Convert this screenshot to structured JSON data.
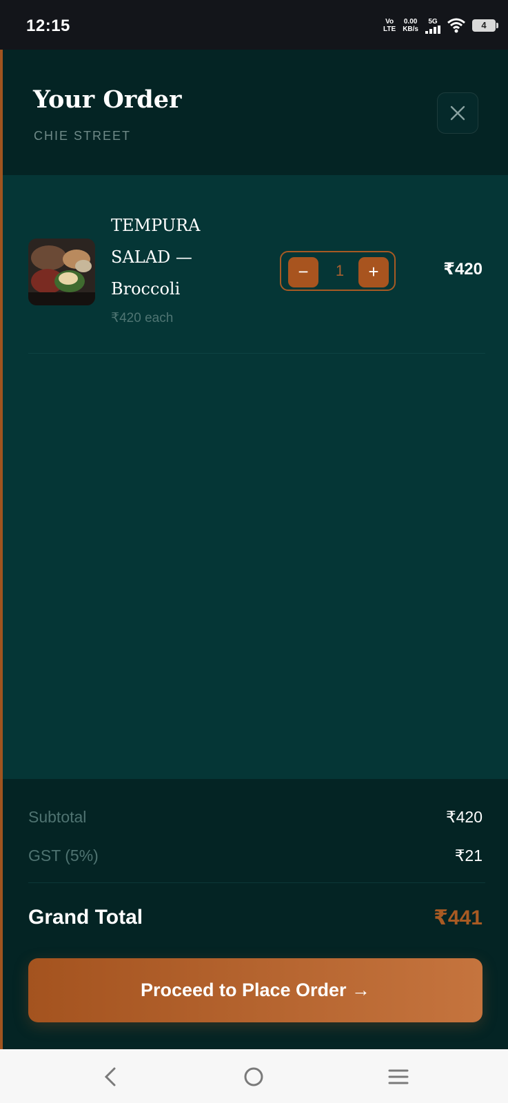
{
  "status_bar": {
    "time": "12:15",
    "volte_top": "Vo",
    "volte_bottom": "LTE",
    "speed_top": "0.00",
    "speed_bottom": "KB/s",
    "network": "5G",
    "battery": "4"
  },
  "header": {
    "title": "Your Order",
    "subtitle": "CHIE STREET",
    "close_icon": "close-icon"
  },
  "items": [
    {
      "name": "TEMPURA SALAD — Broccoli",
      "unit_price": "₹420 each",
      "quantity": "1",
      "minus_label": "−",
      "plus_label": "+",
      "total": "₹420"
    }
  ],
  "summary": {
    "subtotal_label": "Subtotal",
    "subtotal_value": "₹420",
    "gst_label": "GST (5%)",
    "gst_value": "₹21",
    "grand_total_label": "Grand Total",
    "grand_total_value": "₹441"
  },
  "cta": {
    "label": "Proceed to Place Order →"
  },
  "nav": {
    "back_icon": "back-icon",
    "home_icon": "home-icon",
    "menu_icon": "menu-icon"
  },
  "colors": {
    "accent": "#a85a23",
    "background": "#053636",
    "header_bg": "#042424"
  }
}
